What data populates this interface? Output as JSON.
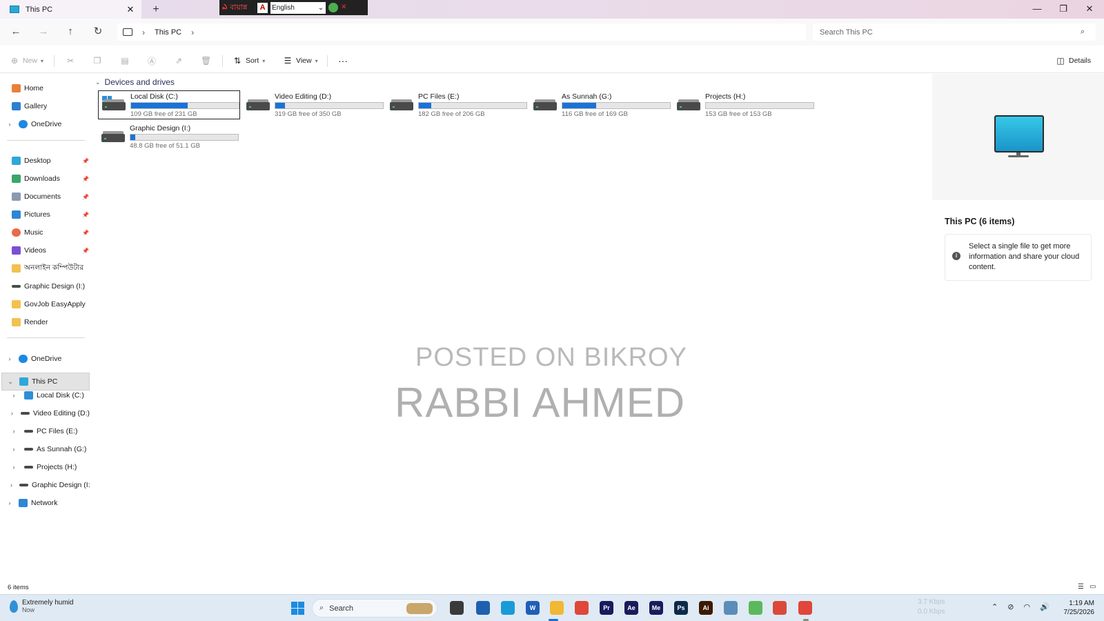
{
  "window": {
    "tab_title": "This PC",
    "close_tab_glyph": "✕",
    "new_tab_glyph": "+",
    "minimize_glyph": "—",
    "maximize_glyph": "❐",
    "close_glyph": "✕"
  },
  "ime_bar": {
    "language_label": "বায়ান্ন",
    "a_glyph": "A",
    "selected_keyboard": "English"
  },
  "address": {
    "crumbs": [
      "This PC"
    ],
    "search_placeholder": "Search This PC"
  },
  "commands": {
    "new": "New",
    "sort": "Sort",
    "view": "View",
    "more": "···",
    "details": "Details"
  },
  "sidebar": {
    "items": [
      {
        "label": "Home",
        "icon": "home-icon",
        "color": "#e8803a"
      },
      {
        "label": "Gallery",
        "icon": "gallery-icon",
        "color": "#2b7fd4"
      },
      {
        "label": "OneDrive",
        "icon": "cloud-icon",
        "color": "#1e88e5"
      },
      {
        "label": "Desktop",
        "icon": "desktop-icon",
        "color": "#2fa7d9",
        "pinned": true
      },
      {
        "label": "Downloads",
        "icon": "download-icon",
        "color": "#3aa56a",
        "pinned": true
      },
      {
        "label": "Documents",
        "icon": "document-icon",
        "color": "#8a9bb0",
        "pinned": true
      },
      {
        "label": "Pictures",
        "icon": "pictures-icon",
        "color": "#2d86d6",
        "pinned": true
      },
      {
        "label": "Music",
        "icon": "music-icon",
        "color": "#e86b4a",
        "pinned": true
      },
      {
        "label": "Videos",
        "icon": "videos-icon",
        "color": "#7b4fd6",
        "pinned": true
      },
      {
        "label": "অনলাইন কম্পিউটার",
        "icon": "folder-icon",
        "color": "#f2c14e"
      },
      {
        "label": "Graphic Design (I:)",
        "icon": "drive-icon",
        "color": "#4a4a4a"
      },
      {
        "label": "GovJob EasyApply",
        "icon": "folder-icon",
        "color": "#f2c14e"
      },
      {
        "label": "Render",
        "icon": "folder-icon",
        "color": "#f2c14e"
      },
      {
        "label": "OneDrive",
        "icon": "cloud-icon",
        "color": "#1e88e5"
      },
      {
        "label": "This PC",
        "icon": "computer-icon",
        "color": "#2fa7d9"
      },
      {
        "label": "Local Disk (C:)",
        "icon": "drive-icon",
        "color": "#2d8fd8"
      },
      {
        "label": "Video Editing (D:)",
        "icon": "drive-icon",
        "color": "#4a4a4a"
      },
      {
        "label": "PC Files (E:)",
        "icon": "drive-icon",
        "color": "#4a4a4a"
      },
      {
        "label": "As Sunnah (G:)",
        "icon": "drive-icon",
        "color": "#4a4a4a"
      },
      {
        "label": "Projects (H:)",
        "icon": "drive-icon",
        "color": "#4a4a4a"
      },
      {
        "label": "Graphic Design (I:)",
        "icon": "drive-icon",
        "color": "#4a4a4a"
      },
      {
        "label": "Network",
        "icon": "network-icon",
        "color": "#2d86d6"
      }
    ]
  },
  "main": {
    "group_title": "Devices and drives",
    "drives": [
      {
        "name": "Local Disk (C:)",
        "free": "109 GB free of 231 GB",
        "used_fraction": 0.528,
        "selected": true
      },
      {
        "name": "Video Editing (D:)",
        "free": "319 GB free of 350 GB",
        "used_fraction": 0.089
      },
      {
        "name": "PC Files (E:)",
        "free": "182 GB free of 206 GB",
        "used_fraction": 0.117
      },
      {
        "name": "As Sunnah (G:)",
        "free": "116 GB free of 169 GB",
        "used_fraction": 0.314
      },
      {
        "name": "Projects (H:)",
        "free": "153 GB free of 153 GB",
        "used_fraction": 0.0
      },
      {
        "name": "Graphic Design (I:)",
        "free": "48.8 GB free of 51.1 GB",
        "used_fraction": 0.045
      }
    ],
    "watermark_line1": "POSTED ON BIKROY",
    "watermark_line2": "RABBI AHMED"
  },
  "details": {
    "title": "This PC (6 items)",
    "info_text": "Select a single file to get more information and share your cloud content.",
    "info_glyph": "i"
  },
  "status": {
    "item_count": "6 items"
  },
  "taskbar": {
    "weather_line1": "Extremely humid",
    "weather_line2": "Now",
    "search_label": "Search",
    "net_up": "3.7 Kbps",
    "net_down": "0.0 Kbps",
    "time": "1:19 AM",
    "date": "7/25/2026",
    "apps": [
      {
        "name": "task-view-icon",
        "label": "",
        "color": "#3a3a3a"
      },
      {
        "name": "store-icon",
        "label": "",
        "color": "#1f5fb0"
      },
      {
        "name": "edge-icon",
        "label": "",
        "color": "#1a9bd7"
      },
      {
        "name": "word-icon",
        "label": "W",
        "color": "#1f5fb8"
      },
      {
        "name": "file-explorer-icon",
        "label": "",
        "color": "#f2b733"
      },
      {
        "name": "chrome-icon",
        "label": "",
        "color": "#e0463a"
      },
      {
        "name": "premiere-icon",
        "label": "Pr",
        "color": "#1a1a5c"
      },
      {
        "name": "after-effects-icon",
        "label": "Ae",
        "color": "#1a1a5c"
      },
      {
        "name": "media-encoder-icon",
        "label": "Me",
        "color": "#1a1a5c"
      },
      {
        "name": "photoshop-icon",
        "label": "Ps",
        "color": "#0b2a4a"
      },
      {
        "name": "illustrator-icon",
        "label": "Ai",
        "color": "#3a1a00"
      },
      {
        "name": "app-window-icon",
        "label": "",
        "color": "#5b8db8"
      },
      {
        "name": "green-app-icon",
        "label": "",
        "color": "#5cb85c"
      },
      {
        "name": "color-app-icon",
        "label": "",
        "color": "#d94a3a"
      },
      {
        "name": "chrome-profile-icon",
        "label": "",
        "color": "#e0463a"
      }
    ]
  }
}
